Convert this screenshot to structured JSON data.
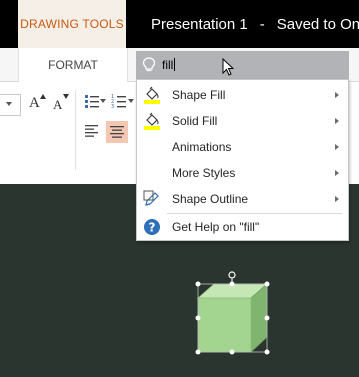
{
  "titlebar": {
    "context_tab": "DRAWING TOOLS",
    "doc_title": "Presentation 1",
    "separator": "-",
    "status": "Saved to One"
  },
  "tabs": {
    "format": "FORMAT"
  },
  "tell_me": {
    "query": "fill",
    "bulb_icon": "lightbulb-icon"
  },
  "ribbon": {
    "grow_font": "A",
    "shrink_font": "A",
    "grow_font_icon": "grow-font-icon",
    "shrink_font_icon": "shrink-font-icon",
    "bullets_icon": "bullets-icon",
    "numbering_icon": "numbering-icon",
    "align_left_icon": "align-left-icon",
    "align_center_icon": "align-center-icon",
    "align_center_highlight": "#f4c7b3"
  },
  "menu": {
    "items": [
      {
        "label": "Shape Fill",
        "icon": "paint-bucket-icon",
        "has_submenu": true
      },
      {
        "label": "Solid Fill",
        "icon": "paint-bucket-icon",
        "has_submenu": true
      },
      {
        "label": "Animations",
        "icon": "",
        "has_submenu": true
      },
      {
        "label": "More Styles",
        "icon": "",
        "has_submenu": true
      },
      {
        "label": "Shape Outline",
        "icon": "pencil-icon",
        "has_submenu": true
      }
    ],
    "help": {
      "label": "Get Help on \"fill\"",
      "icon": "help-icon"
    }
  },
  "colors": {
    "titlebar_bg": "#000000",
    "context_tab_text": "#c55a11",
    "context_tab_bg": "#f6efe7",
    "slide_bg": "#2b3530",
    "cube_front": "#a3d490",
    "cube_top": "#c5e6b5",
    "cube_side": "#7fb56e",
    "fill_swatch": "#ffff00",
    "help_icon": "#2e6fb7"
  },
  "slide": {
    "shape": "cube"
  }
}
